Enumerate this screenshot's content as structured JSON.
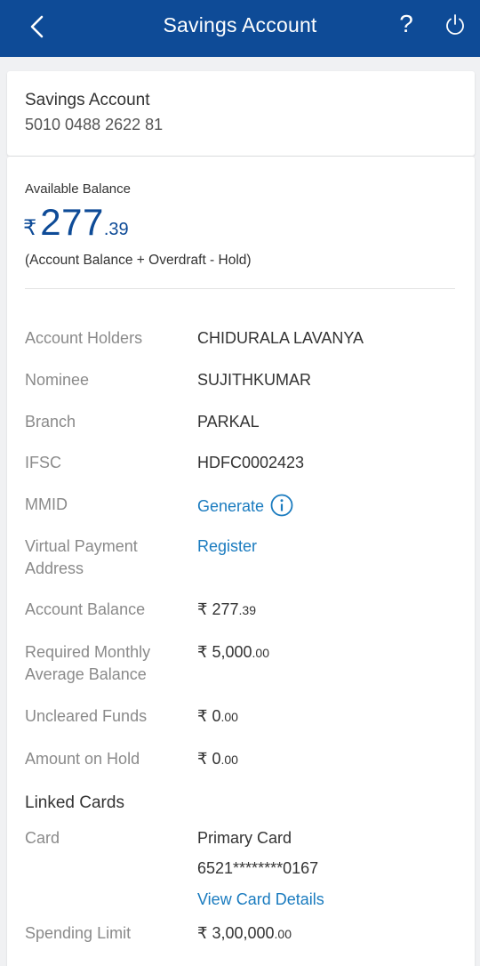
{
  "header": {
    "title": "Savings Account",
    "back_icon": "chevron-left-icon",
    "help_label": "?",
    "power_icon": "power-icon",
    "bg_color": "#0e4b97"
  },
  "account": {
    "name": "Savings Account",
    "number": "5010 0488 2622 81"
  },
  "balance": {
    "label": "Available Balance",
    "currency": "₹",
    "whole": "277",
    "decimal": ".39",
    "note": "(Account Balance + Overdraft - Hold)"
  },
  "details": {
    "holders": {
      "label": "Account Holders",
      "value": "CHIDURALA LAVANYA"
    },
    "nominee": {
      "label": "Nominee",
      "value": "SUJITHKUMAR"
    },
    "branch": {
      "label": "Branch",
      "value": "PARKAL"
    },
    "ifsc": {
      "label": "IFSC",
      "value": "HDFC0002423"
    },
    "mmid": {
      "label": "MMID",
      "value": "Generate",
      "icon": "info-icon"
    },
    "vpa": {
      "label": "Virtual Payment Address",
      "value": "Register"
    },
    "acct_balance": {
      "label": "Account Balance",
      "currency": "₹",
      "whole": "277",
      "cents": ".39"
    },
    "min_balance": {
      "label": "Required Monthly Average Balance",
      "currency": "₹",
      "whole": "5,000",
      "cents": ".00"
    },
    "uncleared": {
      "label": "Uncleared Funds",
      "currency": "₹",
      "whole": "0",
      "cents": ".00"
    },
    "on_hold": {
      "label": "Amount on Hold",
      "currency": "₹",
      "whole": "0",
      "cents": ".00"
    }
  },
  "linked_cards": {
    "heading": "Linked Cards",
    "card_label": "Card",
    "card_type": "Primary Card",
    "card_number": "6521********0167",
    "view_link": "View Card Details",
    "limit_label": "Spending Limit",
    "limit_currency": "₹",
    "limit_whole": "3,00,000",
    "limit_cents": ".00"
  },
  "colors": {
    "accent": "#0e4b97",
    "link": "#1a7bbf"
  }
}
